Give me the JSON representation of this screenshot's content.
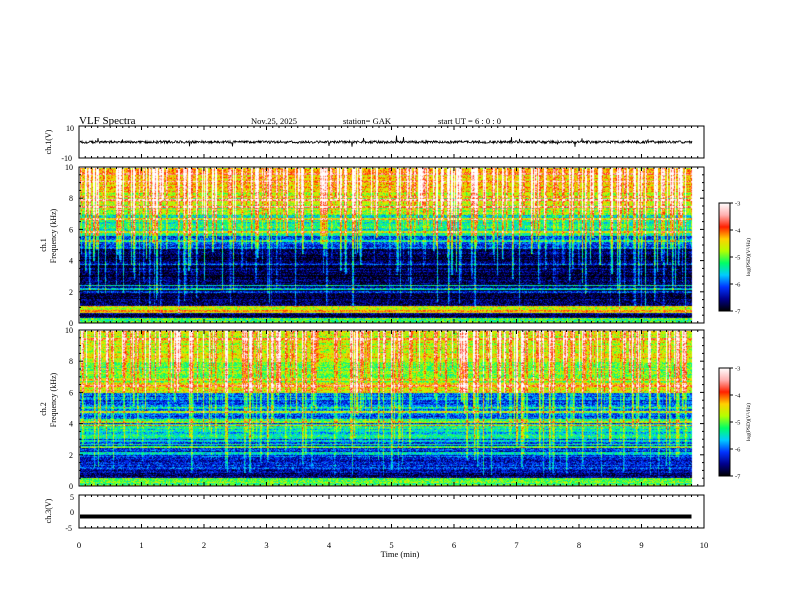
{
  "header": {
    "title": "VLF  Spectra",
    "date": "Nov.25,  2025",
    "station": "station= GAK",
    "start_ut": "start  UT  =    6  : 0   : 0"
  },
  "colors": {
    "background": "#ffffff",
    "waveform": "#000000",
    "colorbar": [
      "#000000",
      "#00008b",
      "#0033ff",
      "#00ccff",
      "#00ff66",
      "#b4ff00",
      "#ffd000",
      "#ff2000",
      "#ffb0b0",
      "#ffffff"
    ]
  },
  "chart_data": [
    {
      "type": "line",
      "panel": "ch1-waveform",
      "ylabel": "ch.1(V)",
      "ylim": [
        -10,
        10
      ],
      "y_ticks": [
        "10",
        "-10"
      ],
      "xlim": [
        0,
        10
      ],
      "baseline": 0,
      "note_series": "noisy waveform around 0 V with sparse spikes reaching about +3 and -3 V, data ends near 9.8 min"
    },
    {
      "type": "heatmap",
      "panel": "ch1-spectrogram",
      "ylabel": "Frequency  (kHz)",
      "channel_label": "ch.1",
      "ylim": [
        0,
        10
      ],
      "y_ticks": [
        "0",
        "2",
        "4",
        "6",
        "8",
        "10"
      ],
      "xlim": [
        0,
        10
      ],
      "data_end_min": 9.8,
      "colorbar": {
        "label": "log(PSD)(V²/Hz)",
        "range": [
          -7,
          -3
        ],
        "ticks": [
          "-3",
          "-4",
          "-5",
          "-6",
          "-7"
        ]
      },
      "band_levels_log_psd": [
        {
          "from_khz": 0.0,
          "to_khz": 0.3,
          "level": -5.2
        },
        {
          "from_khz": 0.3,
          "to_khz": 0.6,
          "level": -6.7
        },
        {
          "from_khz": 0.6,
          "to_khz": 1.1,
          "level": -4.6
        },
        {
          "from_khz": 1.1,
          "to_khz": 4.8,
          "level": -6.8
        },
        {
          "from_khz": 4.8,
          "to_khz": 5.6,
          "level": -6.1
        },
        {
          "from_khz": 5.6,
          "to_khz": 7.0,
          "level": -5.4
        },
        {
          "from_khz": 7.0,
          "to_khz": 8.5,
          "level": -4.8
        },
        {
          "from_khz": 8.5,
          "to_khz": 10.0,
          "level": -4.4
        }
      ]
    },
    {
      "type": "heatmap",
      "panel": "ch2-spectrogram",
      "ylabel": "Frequency  (kHz)",
      "channel_label": "ch.2",
      "ylim": [
        0,
        10
      ],
      "y_ticks": [
        "0",
        "2",
        "4",
        "6",
        "8",
        "10"
      ],
      "xlim": [
        0,
        10
      ],
      "data_end_min": 9.8,
      "colorbar": {
        "label": "log(PSD)(V²/Hz)",
        "range": [
          -7,
          -3
        ],
        "ticks": [
          "-3",
          "-4",
          "-5",
          "-6",
          "-7"
        ]
      },
      "band_levels_log_psd": [
        {
          "from_khz": 0.0,
          "to_khz": 0.5,
          "level": -5.0
        },
        {
          "from_khz": 0.5,
          "to_khz": 1.0,
          "level": -6.6
        },
        {
          "from_khz": 1.0,
          "to_khz": 3.0,
          "level": -6.2
        },
        {
          "from_khz": 3.0,
          "to_khz": 4.0,
          "level": -5.5
        },
        {
          "from_khz": 4.0,
          "to_khz": 6.0,
          "level": -6.0
        },
        {
          "from_khz": 6.0,
          "to_khz": 6.5,
          "level": -4.6
        },
        {
          "from_khz": 6.5,
          "to_khz": 8.0,
          "level": -5.0
        },
        {
          "from_khz": 8.0,
          "to_khz": 10.0,
          "level": -4.6
        }
      ]
    },
    {
      "type": "line",
      "panel": "ch3-waveform",
      "ylabel": "ch.3(V)",
      "ylim": [
        -5,
        5
      ],
      "y_ticks": [
        "5",
        "0",
        "-5"
      ],
      "xlim": [
        0,
        10
      ],
      "baseline": -1.5,
      "note_series": "flat dense trace near -1.5 V, data ends near 9.8 min"
    }
  ],
  "x_axis": {
    "label": "Time  (min)",
    "ticks": [
      "0",
      "1",
      "2",
      "3",
      "4",
      "5",
      "6",
      "7",
      "8",
      "9",
      "10"
    ]
  }
}
